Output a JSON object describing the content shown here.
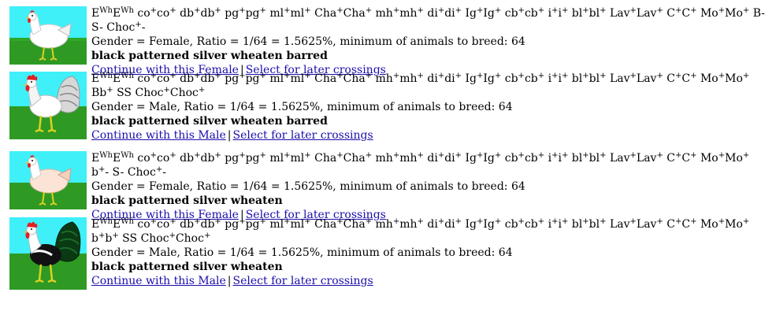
{
  "entries": [
    {
      "genotype": [
        [
          "E",
          "Wh"
        ],
        [
          "E",
          "Wh"
        ],
        " ",
        [
          "co",
          "+"
        ],
        [
          "co",
          "+"
        ],
        " ",
        [
          "db",
          "+"
        ],
        [
          "db",
          "+"
        ],
        " ",
        [
          "pg",
          "+"
        ],
        [
          "pg",
          "+"
        ],
        " ",
        [
          "ml",
          "+"
        ],
        [
          "ml",
          "+"
        ],
        " ",
        [
          "Cha",
          "+"
        ],
        [
          "Cha",
          "+"
        ],
        " ",
        [
          "mh",
          "+"
        ],
        [
          "mh",
          "+"
        ],
        " ",
        [
          "di",
          "+"
        ],
        [
          "di",
          "+"
        ],
        " ",
        [
          "Ig",
          "+"
        ],
        [
          "Ig",
          "+"
        ],
        " ",
        [
          "cb",
          "+"
        ],
        [
          "cb",
          "+"
        ],
        " ",
        [
          "i",
          "+"
        ],
        [
          "i",
          "+"
        ],
        " ",
        [
          "bl",
          "+"
        ],
        [
          "bl",
          "+"
        ],
        " ",
        [
          "Lav",
          "+"
        ],
        [
          "Lav",
          "+"
        ],
        " ",
        [
          "C",
          "+"
        ],
        [
          "C",
          "+"
        ],
        " ",
        [
          "Mo",
          "+"
        ],
        [
          "Mo",
          "+"
        ],
        " ",
        "B- S- ",
        [
          "Choc",
          "+"
        ],
        "-"
      ],
      "gender_line": "Gender = Female, Ratio = 1/64 = 1.5625%, minimum of animals to breed: 64",
      "phenotype": "black patterned silver wheaten barred",
      "continue_link": "Continue with this Female",
      "separator": "|",
      "select_link": "Select for later crossings",
      "icon": "hen-white-icon"
    },
    {
      "genotype": [
        [
          "E",
          "Wh"
        ],
        [
          "E",
          "Wh"
        ],
        " ",
        [
          "co",
          "+"
        ],
        [
          "co",
          "+"
        ],
        " ",
        [
          "db",
          "+"
        ],
        [
          "db",
          "+"
        ],
        " ",
        [
          "pg",
          "+"
        ],
        [
          "pg",
          "+"
        ],
        " ",
        [
          "ml",
          "+"
        ],
        [
          "ml",
          "+"
        ],
        " ",
        [
          "Cha",
          "+"
        ],
        [
          "Cha",
          "+"
        ],
        " ",
        [
          "mh",
          "+"
        ],
        [
          "mh",
          "+"
        ],
        " ",
        [
          "di",
          "+"
        ],
        [
          "di",
          "+"
        ],
        " ",
        [
          "Ig",
          "+"
        ],
        [
          "Ig",
          "+"
        ],
        " ",
        [
          "cb",
          "+"
        ],
        [
          "cb",
          "+"
        ],
        " ",
        [
          "i",
          "+"
        ],
        [
          "i",
          "+"
        ],
        " ",
        [
          "bl",
          "+"
        ],
        [
          "bl",
          "+"
        ],
        " ",
        [
          "Lav",
          "+"
        ],
        [
          "Lav",
          "+"
        ],
        " ",
        [
          "C",
          "+"
        ],
        [
          "C",
          "+"
        ],
        " ",
        [
          "Mo",
          "+"
        ],
        [
          "Mo",
          "+"
        ],
        " Bb",
        [
          "",
          "+"
        ],
        " SS ",
        [
          "Choc",
          "+"
        ],
        [
          "Choc",
          "+"
        ]
      ],
      "gender_line": "Gender = Male, Ratio = 1/64 = 1.5625%, minimum of animals to breed: 64",
      "phenotype": "black patterned silver wheaten barred",
      "continue_link": "Continue with this Male",
      "separator": "|",
      "select_link": "Select for later crossings",
      "icon": "rooster-grey-icon"
    },
    {
      "genotype": [
        [
          "E",
          "Wh"
        ],
        [
          "E",
          "Wh"
        ],
        " ",
        [
          "co",
          "+"
        ],
        [
          "co",
          "+"
        ],
        " ",
        [
          "db",
          "+"
        ],
        [
          "db",
          "+"
        ],
        " ",
        [
          "pg",
          "+"
        ],
        [
          "pg",
          "+"
        ],
        " ",
        [
          "ml",
          "+"
        ],
        [
          "ml",
          "+"
        ],
        " ",
        [
          "Cha",
          "+"
        ],
        [
          "Cha",
          "+"
        ],
        " ",
        [
          "mh",
          "+"
        ],
        [
          "mh",
          "+"
        ],
        " ",
        [
          "di",
          "+"
        ],
        [
          "di",
          "+"
        ],
        " ",
        [
          "Ig",
          "+"
        ],
        [
          "Ig",
          "+"
        ],
        " ",
        [
          "cb",
          "+"
        ],
        [
          "cb",
          "+"
        ],
        " ",
        [
          "i",
          "+"
        ],
        [
          "i",
          "+"
        ],
        " ",
        [
          "bl",
          "+"
        ],
        [
          "bl",
          "+"
        ],
        " ",
        [
          "Lav",
          "+"
        ],
        [
          "Lav",
          "+"
        ],
        " ",
        [
          "C",
          "+"
        ],
        [
          "C",
          "+"
        ],
        " ",
        [
          "Mo",
          "+"
        ],
        [
          "Mo",
          "+"
        ],
        " ",
        [
          "b",
          "+"
        ],
        "- S- ",
        [
          "Choc",
          "+"
        ],
        "-"
      ],
      "gender_line": "Gender = Female, Ratio = 1/64 = 1.5625%, minimum of animals to breed: 64",
      "phenotype": "black patterned silver wheaten",
      "continue_link": "Continue with this Female",
      "separator": "|",
      "select_link": "Select for later crossings",
      "icon": "hen-peach-icon"
    },
    {
      "genotype": [
        [
          "E",
          "Wh"
        ],
        [
          "E",
          "Wh"
        ],
        " ",
        [
          "co",
          "+"
        ],
        [
          "co",
          "+"
        ],
        " ",
        [
          "db",
          "+"
        ],
        [
          "db",
          "+"
        ],
        " ",
        [
          "pg",
          "+"
        ],
        [
          "pg",
          "+"
        ],
        " ",
        [
          "ml",
          "+"
        ],
        [
          "ml",
          "+"
        ],
        " ",
        [
          "Cha",
          "+"
        ],
        [
          "Cha",
          "+"
        ],
        " ",
        [
          "mh",
          "+"
        ],
        [
          "mh",
          "+"
        ],
        " ",
        [
          "di",
          "+"
        ],
        [
          "di",
          "+"
        ],
        " ",
        [
          "Ig",
          "+"
        ],
        [
          "Ig",
          "+"
        ],
        " ",
        [
          "cb",
          "+"
        ],
        [
          "cb",
          "+"
        ],
        " ",
        [
          "i",
          "+"
        ],
        [
          "i",
          "+"
        ],
        " ",
        [
          "bl",
          "+"
        ],
        [
          "bl",
          "+"
        ],
        " ",
        [
          "Lav",
          "+"
        ],
        [
          "Lav",
          "+"
        ],
        " ",
        [
          "C",
          "+"
        ],
        [
          "C",
          "+"
        ],
        " ",
        [
          "Mo",
          "+"
        ],
        [
          "Mo",
          "+"
        ],
        " ",
        [
          "b",
          "+"
        ],
        [
          "b",
          "+"
        ],
        " SS ",
        [
          "Choc",
          "+"
        ],
        [
          "Choc",
          "+"
        ]
      ],
      "gender_line": "Gender = Male, Ratio = 1/64 = 1.5625%, minimum of animals to breed: 64",
      "phenotype": "black patterned silver wheaten",
      "continue_link": "Continue with this Male",
      "separator": "|",
      "select_link": "Select for later crossings",
      "icon": "rooster-black-icon"
    }
  ],
  "colors": {
    "link": "#1a0dab",
    "sky": "#3ff0f8",
    "grass": "#3a9a2a"
  }
}
